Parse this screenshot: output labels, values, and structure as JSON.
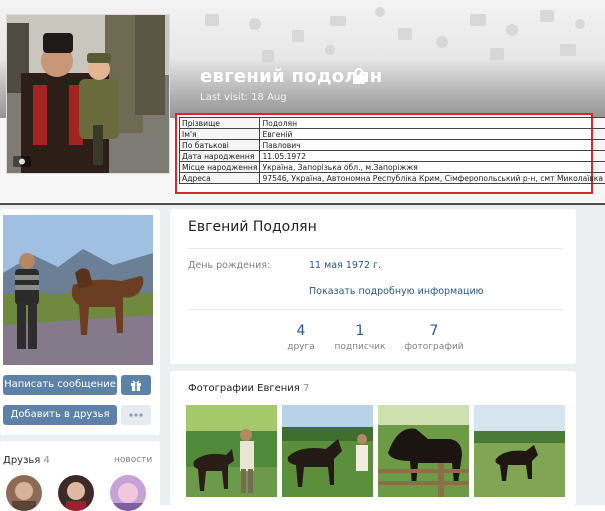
{
  "profile": {
    "name": "евгений подолян",
    "last_visit": "Last visit: 18 Aug"
  },
  "info_table": {
    "rows": [
      {
        "key": "Прізвище",
        "value": "Подолян"
      },
      {
        "key": "Ім'я",
        "value": "Евгеній"
      },
      {
        "key": "По батькові",
        "value": "Павлович"
      },
      {
        "key": "Дата народження",
        "value": "11.05.1972"
      },
      {
        "key": "Місце народження",
        "value": "Україна, Запорізька обл., м.Запоріжжя"
      },
      {
        "key": "Адреса",
        "value": "97546, Україна, Автономна Республіка Крим, Сімферопольський р-н, смт Миколаївка"
      }
    ],
    "highlight_color": "#d9272e"
  },
  "page": {
    "full_name": "Евгений Подолян",
    "birthday_label": "День рождения:",
    "birthday_value": "11 мая 1972 г.",
    "show_more": "Показать подробную информацию",
    "counters": [
      {
        "num": "4",
        "label": "друга"
      },
      {
        "num": "1",
        "label": "подписчик"
      },
      {
        "num": "7",
        "label": "фотографий"
      }
    ]
  },
  "actions": {
    "message_label": "Написать сообщение",
    "add_friend_label": "Добавить в друзья",
    "gift_icon": "gift-icon",
    "more_icon": "more-dots-icon"
  },
  "friends": {
    "title": "Друзья",
    "count": "4",
    "more": "новости"
  },
  "photos": {
    "title": "Фотографии Евгения",
    "count": "7"
  },
  "colors": {
    "accent_blue": "#5e81a8",
    "link_blue": "#2a5885",
    "page_bg": "#edeef0"
  }
}
